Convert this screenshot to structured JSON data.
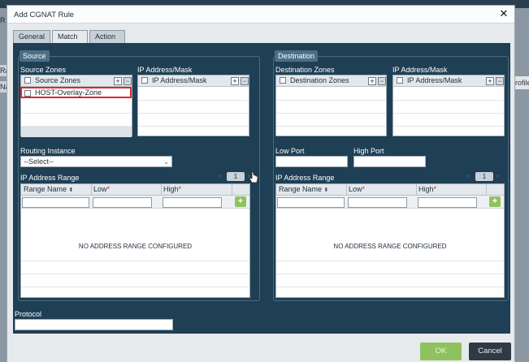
{
  "background": {
    "left_fragments": [
      "R",
      "Ra",
      "Na"
    ],
    "right_fragment": "rofile"
  },
  "dialog": {
    "title": "Add CGNAT Rule",
    "close_glyph": "✕",
    "tabs": [
      {
        "label": "General",
        "active": false
      },
      {
        "label": "Match",
        "active": true
      },
      {
        "label": "Action",
        "active": false
      }
    ],
    "buttons": {
      "ok": "OK",
      "cancel": "Cancel"
    }
  },
  "source": {
    "legend": "Source",
    "zones": {
      "label": "Source Zones",
      "header": "Source Zones",
      "items": [
        "HOST-Overlay-Zone"
      ]
    },
    "ip": {
      "label": "IP Address/Mask",
      "header": "IP Address/Mask"
    },
    "routing": {
      "label": "Routing Instance",
      "selected": "--Select--"
    },
    "range": {
      "label": "IP Address Range",
      "page": "1",
      "columns": [
        "Range Name",
        "Low",
        "High"
      ],
      "empty": "NO ADDRESS RANGE CONFIGURED"
    }
  },
  "destination": {
    "legend": "Destination",
    "zones": {
      "label": "Destination Zones",
      "header": "Destination Zones"
    },
    "ip": {
      "label": "IP Address/Mask",
      "header": "IP Address/Mask"
    },
    "low_port": {
      "label": "Low Port",
      "value": ""
    },
    "high_port": {
      "label": "High Port",
      "value": ""
    },
    "range": {
      "label": "IP Address Range",
      "page": "1",
      "columns": [
        "Range Name",
        "Low",
        "High"
      ],
      "empty": "NO ADDRESS RANGE CONFIGURED"
    }
  },
  "protocol": {
    "label": "Protocol",
    "value": ""
  },
  "icons": {
    "add": "+",
    "remove": "−",
    "prev": "‹",
    "next": "›",
    "sort": "⬍",
    "dropdown": "⌄",
    "add_range": "+",
    "required": "*"
  },
  "colors": {
    "content_bg": "#1f3f55",
    "legend_bg": "#4a6f86",
    "ok_green": "#8fc25f",
    "cancel_dark": "#2f3a44",
    "highlight_red": "#d9292a"
  }
}
